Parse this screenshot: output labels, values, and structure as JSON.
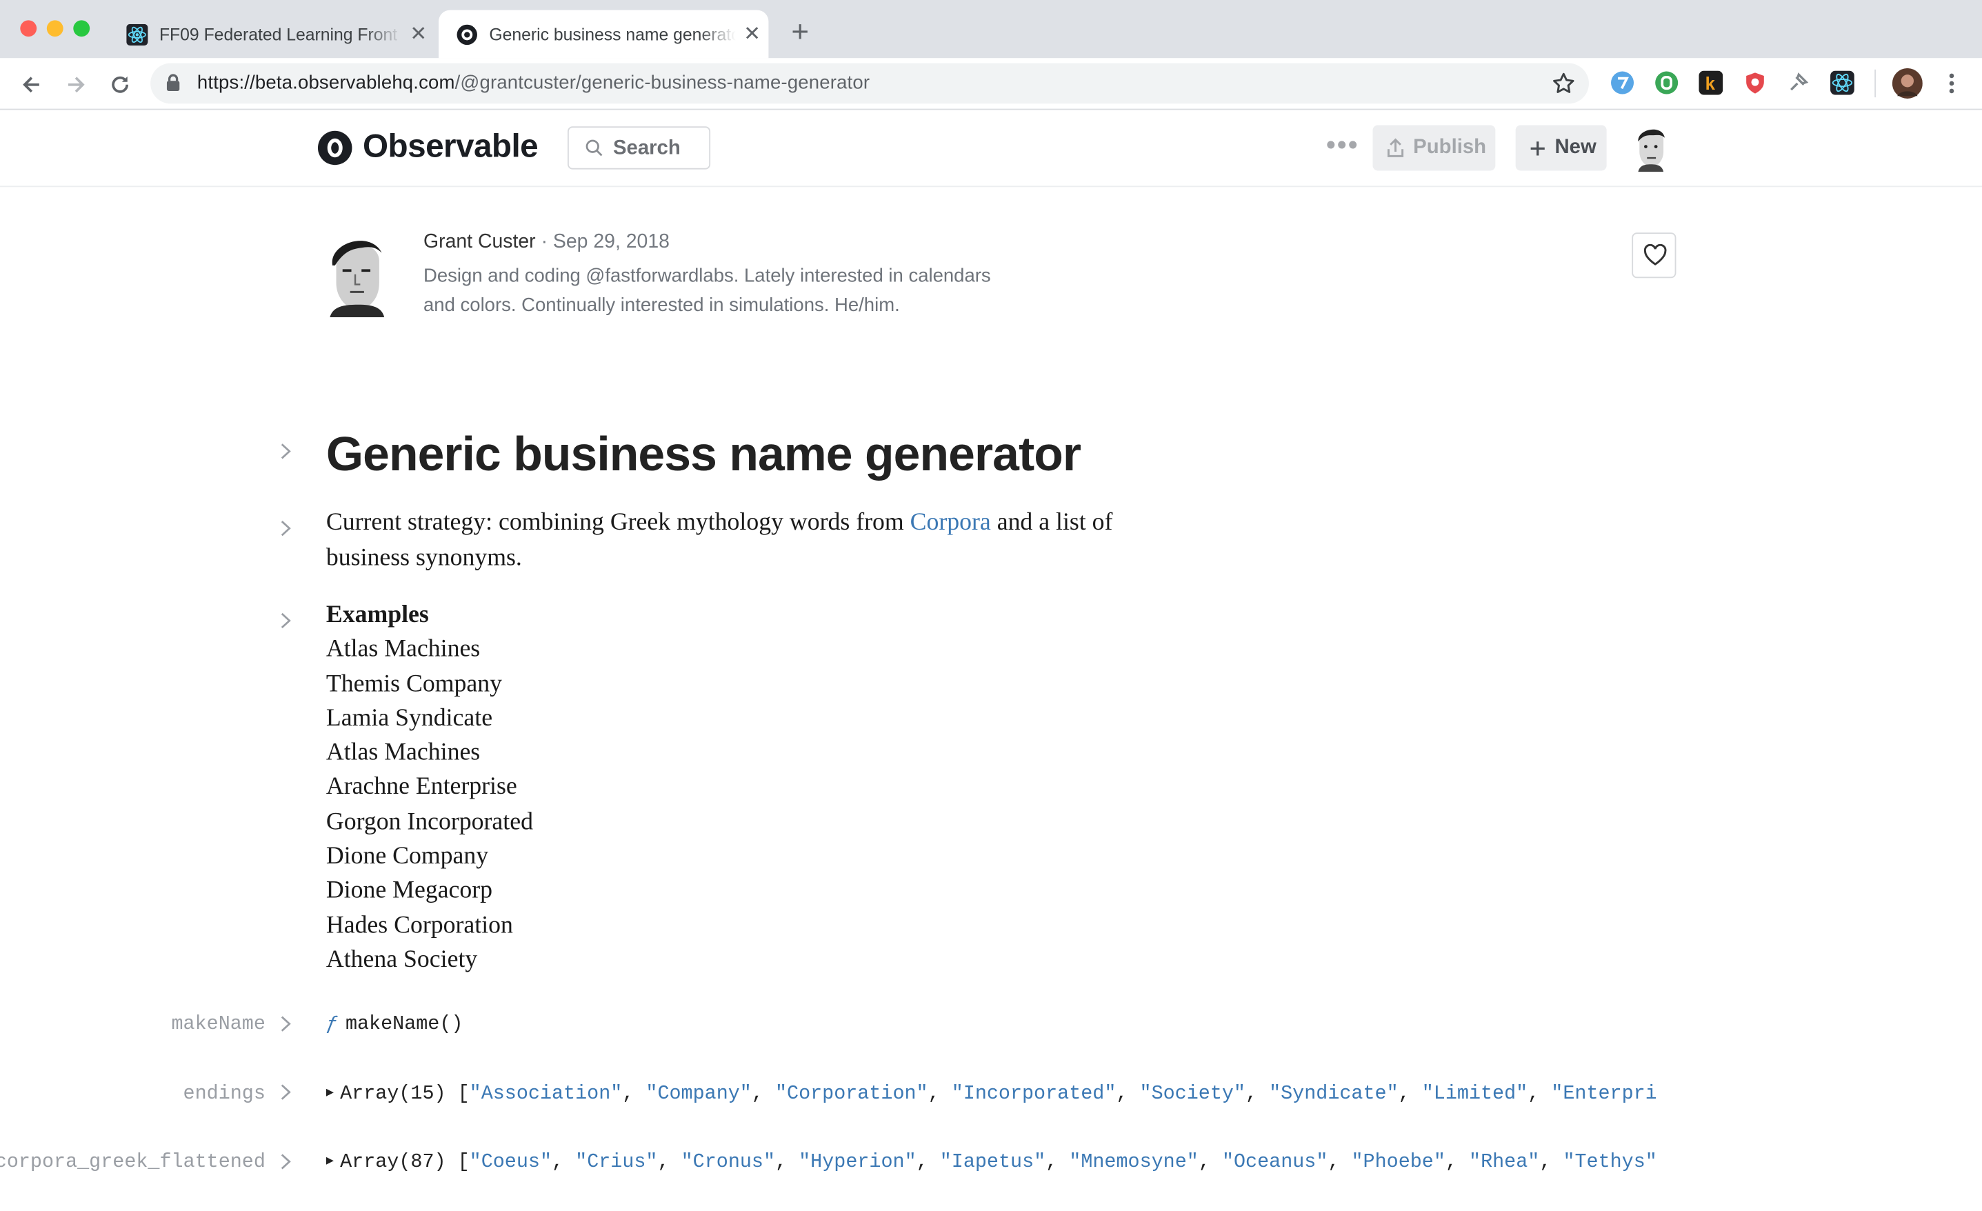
{
  "browser": {
    "tabs": [
      {
        "title": "FF09 Federated Learning Front",
        "active": false
      },
      {
        "title": "Generic business name generator",
        "active": true
      }
    ],
    "url_host": "https://beta.observablehq.com",
    "url_path": "/@grantcuster/generic-business-name-generator"
  },
  "header": {
    "brand": "Observable",
    "search_label": "Search",
    "publish_label": "Publish",
    "new_label": "New"
  },
  "author": {
    "name": "Grant Custer",
    "date": "· Sep 29, 2018",
    "bio_line1": "Design and coding @fastforwardlabs. Lately interested in calendars",
    "bio_line2": "and colors. Continually interested in simulations. He/him."
  },
  "notebook": {
    "title": "Generic business name generator",
    "strategy_before": "Current strategy: combining Greek mythology words from ",
    "strategy_link": "Corpora",
    "strategy_after": " and a list of",
    "strategy_line2": "business synonyms.",
    "examples_heading": "Examples",
    "examples": [
      "Atlas Machines",
      "Themis Company",
      "Lamia Syndicate",
      "Atlas Machines",
      "Arachne Enterprise",
      "Gorgon Incorporated",
      "Dione Company",
      "Dione Megacorp",
      "Hades Corporation",
      "Athena Society"
    ],
    "cells": {
      "makename": {
        "name": "makeName",
        "fn_symbol": "ƒ",
        "value": "makeName()"
      },
      "endings": {
        "name": "endings",
        "prefix": "Array(15) [",
        "items": [
          "\"Association\"",
          "\"Company\"",
          "\"Corporation\"",
          "\"Incorporated\"",
          "\"Society\"",
          "\"Syndicate\"",
          "\"Limited\"",
          "\"Enterpris"
        ]
      },
      "corpora": {
        "name": "corpora_greek_flattened",
        "prefix": "Array(87) [",
        "items": [
          "\"Coeus\"",
          "\"Crius\"",
          "\"Cronus\"",
          "\"Hyperion\"",
          "\"Iapetus\"",
          "\"Mnemosyne\"",
          "\"Oceanus\"",
          "\"Phoebe\"",
          "\"Rhea\"",
          "\"Tethys\""
        ]
      }
    }
  }
}
